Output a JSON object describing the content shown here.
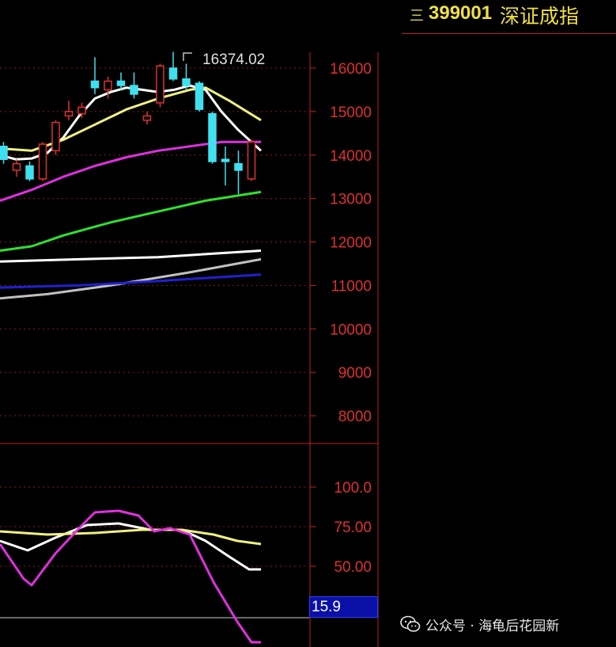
{
  "header": {
    "icon": "menu-lines-icon",
    "icon_glyph": "三",
    "code": "399001",
    "name": "深证成指"
  },
  "indicator_value": "15.9",
  "watermark": {
    "icon": "wechat-icon",
    "text": "公众号 · 海龟后花园新"
  },
  "colors": {
    "axis": "#e03030",
    "up_candle": "#e03030",
    "down_candle": "#40e0f0",
    "ma5": "#ffffff",
    "ma10": "#f0f080",
    "ma20": "#e030e0",
    "ma60": "#30e030",
    "ma120": "#ffffff",
    "ma250": "#c0c0c0",
    "ma_blue": "#2020d0",
    "k_line": "#ffffff",
    "d_line": "#f0f080",
    "j_line": "#e030e0"
  },
  "chart_data": [
    {
      "type": "candlestick",
      "title": "",
      "y_ticks": [
        "16000",
        "15000",
        "14000",
        "13000",
        "12000",
        "11000",
        "10000",
        "9000",
        "8000"
      ],
      "ylim": [
        7700,
        16500
      ],
      "max_label": "16374.02",
      "candles": [
        {
          "o": 14200,
          "c": 13900,
          "h": 14300,
          "l": 13800
        },
        {
          "o": 13650,
          "c": 13800,
          "h": 13900,
          "l": 13500
        },
        {
          "o": 13750,
          "c": 13450,
          "h": 13850,
          "l": 13400
        },
        {
          "o": 13450,
          "c": 14250,
          "h": 14300,
          "l": 13400
        },
        {
          "o": 14100,
          "c": 14750,
          "h": 14800,
          "l": 14000
        },
        {
          "o": 14900,
          "c": 15000,
          "h": 15250,
          "l": 14800
        },
        {
          "o": 14950,
          "c": 15100,
          "h": 15200,
          "l": 14850
        },
        {
          "o": 15700,
          "c": 15550,
          "h": 16250,
          "l": 15400
        },
        {
          "o": 15500,
          "c": 15700,
          "h": 15800,
          "l": 15300
        },
        {
          "o": 15700,
          "c": 15600,
          "h": 15900,
          "l": 15500
        },
        {
          "o": 15600,
          "c": 15400,
          "h": 15900,
          "l": 15300
        },
        {
          "o": 14800,
          "c": 14900,
          "h": 15000,
          "l": 14700
        },
        {
          "o": 15200,
          "c": 16050,
          "h": 16100,
          "l": 15100
        },
        {
          "o": 16000,
          "c": 15750,
          "h": 16374,
          "l": 15700
        },
        {
          "o": 15750,
          "c": 15600,
          "h": 16100,
          "l": 15500
        },
        {
          "o": 15650,
          "c": 15050,
          "h": 15700,
          "l": 15000
        },
        {
          "o": 14950,
          "c": 13850,
          "h": 15000,
          "l": 13800
        },
        {
          "o": 13900,
          "c": 13850,
          "h": 14200,
          "l": 13300
        },
        {
          "o": 13800,
          "c": 13650,
          "h": 14100,
          "l": 13100
        },
        {
          "o": 13450,
          "c": 14300,
          "h": 14350,
          "l": 13400
        }
      ],
      "series": [
        {
          "key": "ma5",
          "values": [
            [
              0,
              14000
            ],
            [
              20,
              13900
            ],
            [
              40,
              13920
            ],
            [
              60,
              14050
            ],
            [
              80,
              14400
            ],
            [
              100,
              14900
            ],
            [
              120,
              15300
            ],
            [
              140,
              15450
            ],
            [
              160,
              15550
            ],
            [
              180,
              15500
            ],
            [
              200,
              15450
            ],
            [
              220,
              15500
            ],
            [
              240,
              15600
            ],
            [
              260,
              15500
            ],
            [
              280,
              15000
            ],
            [
              300,
              14600
            ],
            [
              330,
              14100
            ]
          ]
        },
        {
          "key": "ma10",
          "values": [
            [
              0,
              14150
            ],
            [
              40,
              14100
            ],
            [
              80,
              14350
            ],
            [
              120,
              14700
            ],
            [
              160,
              15050
            ],
            [
              200,
              15300
            ],
            [
              240,
              15500
            ],
            [
              260,
              15550
            ],
            [
              290,
              15250
            ],
            [
              330,
              14800
            ]
          ]
        },
        {
          "key": "ma20",
          "values": [
            [
              0,
              12950
            ],
            [
              40,
              13200
            ],
            [
              80,
              13500
            ],
            [
              120,
              13750
            ],
            [
              160,
              13950
            ],
            [
              200,
              14100
            ],
            [
              240,
              14200
            ],
            [
              280,
              14300
            ],
            [
              330,
              14300
            ]
          ]
        },
        {
          "key": "ma60",
          "values": [
            [
              0,
              11800
            ],
            [
              40,
              11900
            ],
            [
              80,
              12150
            ],
            [
              140,
              12450
            ],
            [
              200,
              12700
            ],
            [
              260,
              12950
            ],
            [
              330,
              13150
            ]
          ]
        },
        {
          "key": "ma120",
          "values": [
            [
              0,
              11550
            ],
            [
              100,
              11600
            ],
            [
              200,
              11650
            ],
            [
              330,
              11800
            ]
          ]
        },
        {
          "key": "ma250",
          "values": [
            [
              0,
              10700
            ],
            [
              60,
              10800
            ],
            [
              140,
              11000
            ],
            [
              240,
              11300
            ],
            [
              330,
              11600
            ]
          ]
        },
        {
          "key": "ma_blue",
          "values": [
            [
              0,
              10950
            ],
            [
              100,
              11000
            ],
            [
              200,
              11100
            ],
            [
              330,
              11250
            ]
          ]
        }
      ]
    },
    {
      "type": "line",
      "title": "",
      "y_ticks": [
        "100.0",
        "75.00",
        "50.00"
      ],
      "ylim": [
        0,
        115
      ],
      "series": [
        {
          "key": "k_line",
          "values": [
            [
              0,
              66
            ],
            [
              35,
              60
            ],
            [
              70,
              68
            ],
            [
              110,
              76
            ],
            [
              150,
              77
            ],
            [
              190,
              73
            ],
            [
              230,
              73
            ],
            [
              260,
              66
            ],
            [
              290,
              56
            ],
            [
              315,
              48
            ],
            [
              330,
              48
            ]
          ]
        },
        {
          "key": "d_line",
          "values": [
            [
              0,
              72
            ],
            [
              60,
              70
            ],
            [
              120,
              71
            ],
            [
              180,
              73
            ],
            [
              230,
              73
            ],
            [
              270,
              70
            ],
            [
              300,
              66
            ],
            [
              330,
              64
            ]
          ]
        },
        {
          "key": "j_line",
          "values": [
            [
              0,
              64
            ],
            [
              30,
              42
            ],
            [
              40,
              38
            ],
            [
              70,
              58
            ],
            [
              100,
              74
            ],
            [
              120,
              84
            ],
            [
              150,
              85
            ],
            [
              175,
              82
            ],
            [
              195,
              72
            ],
            [
              215,
              74
            ],
            [
              240,
              70
            ],
            [
              270,
              40
            ],
            [
              300,
              15
            ],
            [
              318,
              2
            ],
            [
              330,
              2
            ]
          ]
        }
      ]
    }
  ]
}
